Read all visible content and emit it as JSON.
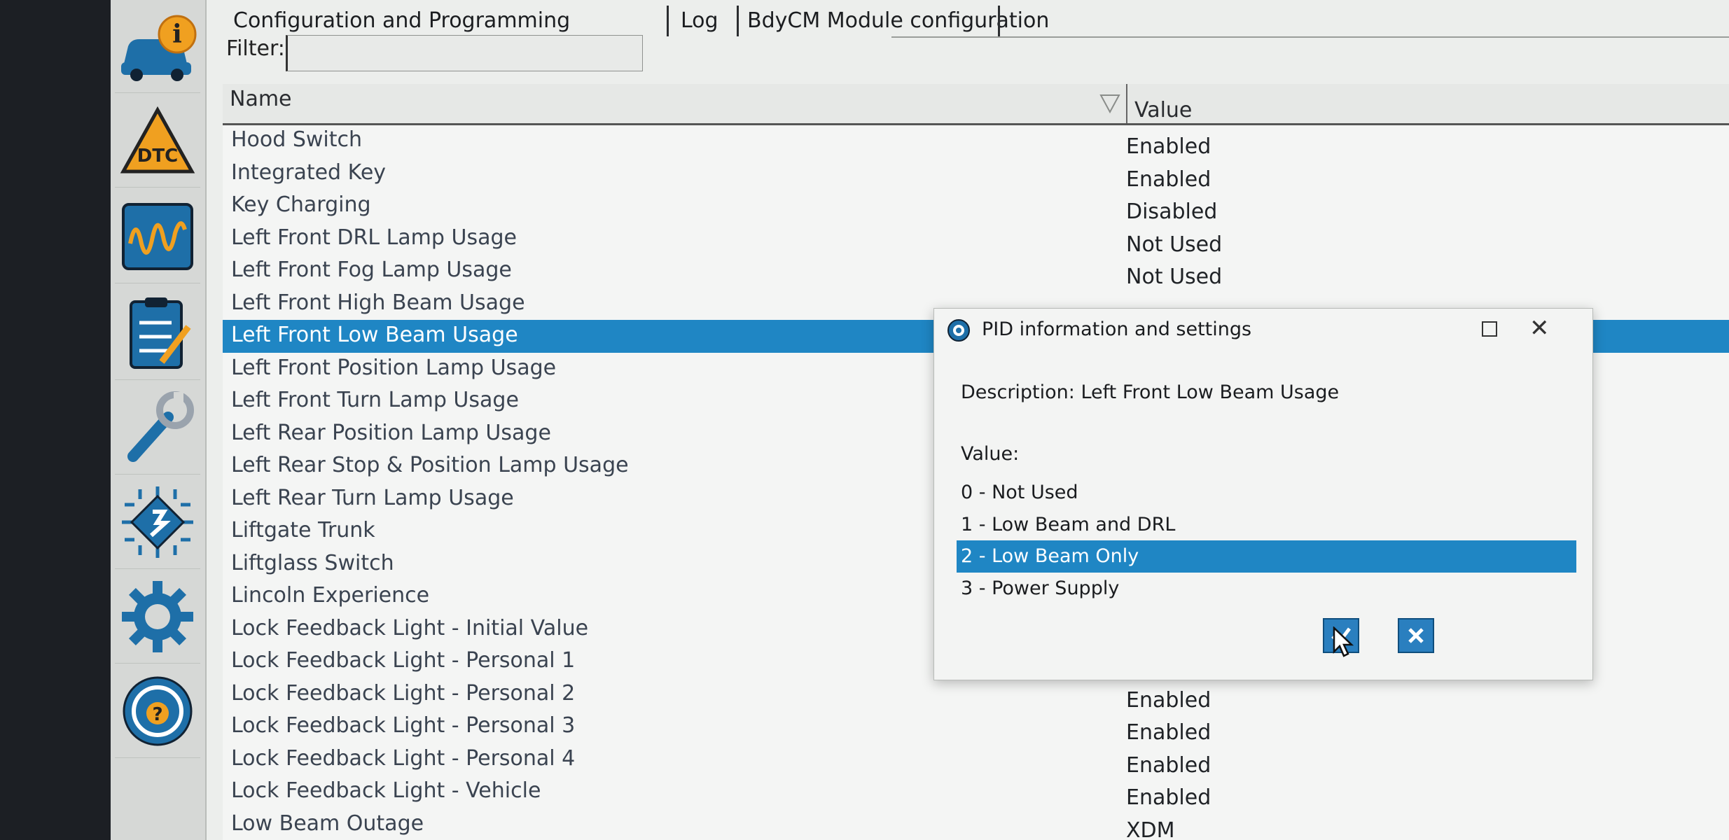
{
  "tabs": [
    {
      "label": "Configuration and Programming"
    },
    {
      "label": "Log"
    },
    {
      "label": "BdyCM Module configuration"
    }
  ],
  "filter": {
    "label": "Filter:",
    "value": ""
  },
  "table": {
    "headers": {
      "name": "Name",
      "value": "Value"
    },
    "rows": [
      {
        "name": "Hood Switch",
        "value": "Enabled"
      },
      {
        "name": "Integrated Key",
        "value": "Enabled"
      },
      {
        "name": "Key Charging",
        "value": "Disabled"
      },
      {
        "name": "Left Front DRL Lamp Usage",
        "value": "Not Used"
      },
      {
        "name": "Left Front Fog Lamp Usage",
        "value": "Not Used"
      },
      {
        "name": "Left Front High Beam Usage",
        "value": ""
      },
      {
        "name": "Left Front Low Beam Usage",
        "value": ""
      },
      {
        "name": "Left Front Position Lamp Usage",
        "value": ""
      },
      {
        "name": "Left Front Turn Lamp Usage",
        "value": ""
      },
      {
        "name": "Left Rear Position Lamp Usage",
        "value": ""
      },
      {
        "name": "Left Rear Stop & Position Lamp Usage",
        "value": ""
      },
      {
        "name": "Left Rear Turn Lamp Usage",
        "value": ""
      },
      {
        "name": "Liftgate Trunk",
        "value": ""
      },
      {
        "name": "Liftglass Switch",
        "value": ""
      },
      {
        "name": "Lincoln Experience",
        "value": ""
      },
      {
        "name": "Lock Feedback Light - Initial Value",
        "value": ""
      },
      {
        "name": "Lock Feedback Light - Personal 1",
        "value": ""
      },
      {
        "name": "Lock Feedback Light - Personal 2",
        "value": "Enabled"
      },
      {
        "name": "Lock Feedback Light - Personal 3",
        "value": "Enabled"
      },
      {
        "name": "Lock Feedback Light - Personal 4",
        "value": "Enabled"
      },
      {
        "name": "Lock Feedback Light - Vehicle",
        "value": "Enabled"
      },
      {
        "name": "Low Beam Outage",
        "value": "XDM"
      }
    ],
    "selected_index": 6
  },
  "dialog": {
    "title": "PID information and settings",
    "description": "Description: Left Front Low Beam Usage",
    "value_label": "Value:",
    "options": [
      {
        "label": "0 - Not Used"
      },
      {
        "label": "1 - Low Beam and DRL"
      },
      {
        "label": "2 - Low Beam Only"
      },
      {
        "label": "3 - Power Supply"
      }
    ],
    "selected_option": 2
  },
  "sidebar_icons": [
    "vehicle-info-icon",
    "dtc-icon",
    "oscilloscope-icon",
    "checklist-icon",
    "wrench-icon",
    "module-chip-icon",
    "settings-gear-icon",
    "help-icon"
  ],
  "colors": {
    "selection": "#1f86c4",
    "accent_orange": "#f0a020",
    "icon_blue": "#1e6fa8"
  }
}
